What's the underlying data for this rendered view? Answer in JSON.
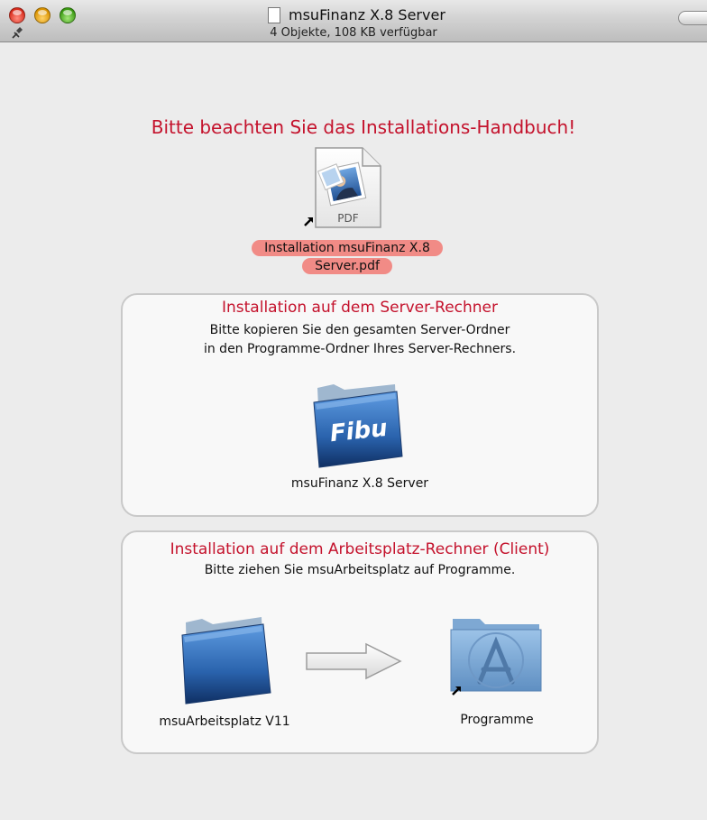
{
  "window": {
    "title": "msuFinanz X.8 Server",
    "status": "4 Objekte, 108 KB verfügbar"
  },
  "headline": "Bitte beachten Sie das Installations-Handbuch!",
  "pdf": {
    "icon_text": "PDF",
    "name": "Installation msuFinanz X.8 Server.pdf"
  },
  "server_section": {
    "title": "Installation auf dem Server-Rechner",
    "line1": "Bitte kopieren Sie den gesamten Server-Ordner",
    "line2": "in den Programme-Ordner Ihres Server-Rechners.",
    "folder_badge": "Fibu",
    "folder_name": "msuFinanz X.8 Server"
  },
  "client_section": {
    "title": "Installation auf dem Arbeitsplatz-Rechner (Client)",
    "text": "Bitte ziehen Sie msuArbeitsplatz auf Programme.",
    "source_name": "msuArbeitsplatz V11",
    "target_name": "Programme"
  },
  "colors": {
    "accent_red": "#c4122c",
    "label_highlight": "#f18b86",
    "folder_blue": "#2a63ad"
  },
  "icons": [
    "close-button",
    "minimize-button",
    "zoom-button",
    "document-icon",
    "pin-icon",
    "pdf-file-icon",
    "alias-arrow-icon",
    "folder-icon",
    "right-arrow-icon",
    "applications-folder-icon"
  ]
}
